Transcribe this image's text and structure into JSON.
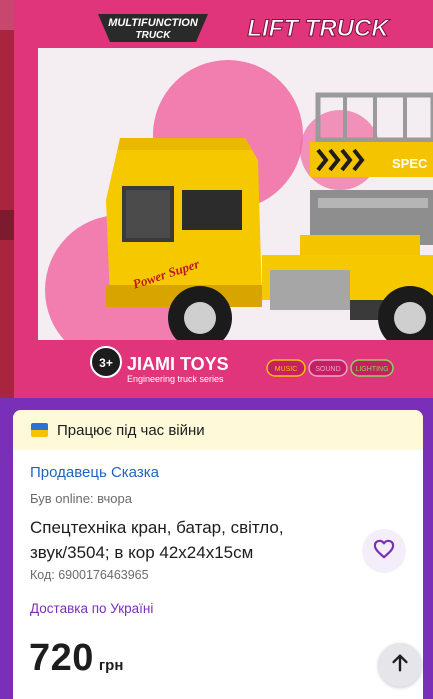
{
  "photo": {
    "box_brand": "MULTIFUNCTION",
    "box_brand_sub": "TRUCK",
    "box_title": "LIFT TRUCK",
    "truck_decal": "Power Super",
    "age_badge": "3+",
    "manufacturer": "JIAMI TOYS",
    "series": "Engineering truck series",
    "badge_music": "MUSIC",
    "badge_sound": "SOUND",
    "badge_lighting": "LIGHTING",
    "platform_label": "SPEC"
  },
  "banner": {
    "text": "Працює під час війни",
    "flag_icon": "ukraine-flag-icon",
    "flag_colors": [
      "#2f6fd6",
      "#f5c300"
    ]
  },
  "listing": {
    "seller": "Продавець Сказка",
    "online": "Був online: вчора",
    "title": "Спецтехніка кран, батар, світло, звук/3504; в кор 42x24x15см",
    "code": "Код: 6900176463965",
    "delivery": "Доставка по Україні",
    "price": "720",
    "currency": "грн",
    "favorite_icon": "heart-outline-icon",
    "scroll_top_icon": "arrow-up-icon"
  },
  "colors": {
    "accent": "#7a2fb8",
    "link": "#1f64c4",
    "banner_bg": "#fdf9d9"
  }
}
